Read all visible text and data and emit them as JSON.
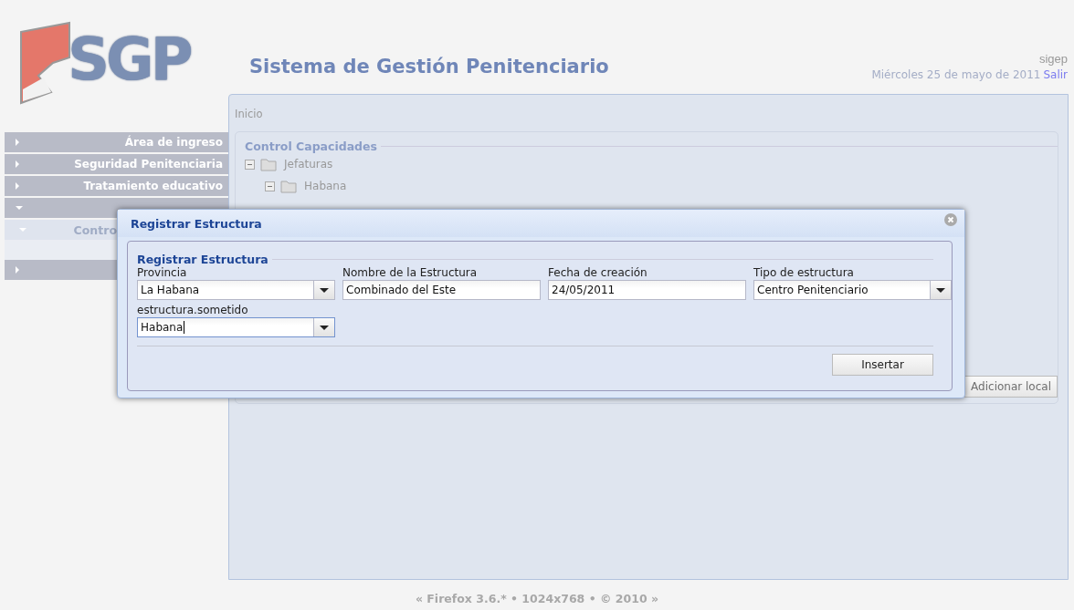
{
  "header": {
    "logo_text": "SGP",
    "title": "Sistema de Gestión Penitenciario",
    "user": "sigep",
    "date": "Miércoles 25 de mayo de 2011",
    "logout_link": "Salir"
  },
  "sidebar": {
    "items": [
      {
        "label": "Área de ingreso",
        "expanded": false
      },
      {
        "label": "Seguridad Penitenciaria",
        "expanded": false
      },
      {
        "label": "Tratamiento educativo",
        "expanded": false
      },
      {
        "expanded": true,
        "children": [
          {
            "label": "Contro",
            "selected": true
          },
          {
            "selected": false
          }
        ]
      },
      {
        "expanded": false
      }
    ]
  },
  "main": {
    "breadcrumb": "Inicio",
    "fieldset_title": "Control Capacidades",
    "tree": [
      {
        "label": "Jefaturas",
        "expanded": true,
        "children": [
          {
            "label": "Habana",
            "expanded": true
          }
        ]
      }
    ],
    "add_button": "Adicionar local"
  },
  "dialog": {
    "title": "Registrar Estructura",
    "fieldset_title": "Registrar Estructura",
    "fields": [
      {
        "label": "Provincia",
        "value": "La Habana",
        "kind": "combo",
        "focused": false
      },
      {
        "label": "Nombre de la Estructura",
        "value": "Combinado del Este",
        "kind": "text",
        "focused": false
      },
      {
        "label": "Fecha de creación",
        "value": "24/05/2011",
        "kind": "text",
        "focused": false
      },
      {
        "label": "Tipo de estructura",
        "value": "Centro Penitenciario",
        "kind": "combo",
        "focused": false
      },
      {
        "label": "estructura.sometido",
        "value": "Habana",
        "kind": "combo",
        "focused": true
      }
    ],
    "submit_button": "Insertar"
  },
  "footer": "« Firefox 3.6.* • 1024x768 • © 2010 »"
}
